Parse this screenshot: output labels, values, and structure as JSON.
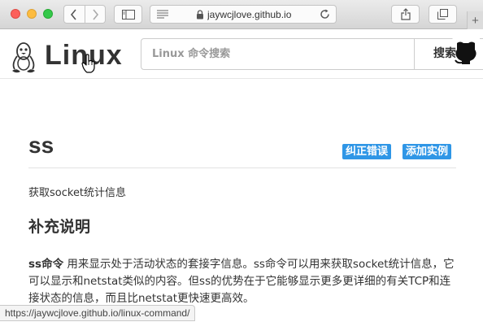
{
  "browser": {
    "url": "jaywcjlove.github.io",
    "status_url": "https://jaywcjlove.github.io/linux-command/",
    "new_tab": "+"
  },
  "header": {
    "logo_text": "Linux",
    "search_placeholder": "Linux 命令搜索",
    "search_button": "搜索"
  },
  "command": {
    "name": "ss",
    "fix_button": "纠正错误",
    "add_example_button": "添加实例",
    "description": "获取socket统计信息"
  },
  "section": {
    "heading": "补充说明",
    "lead_bold": "ss命令",
    "text": " 用来显示处于活动状态的套接字信息。ss命令可以用来获取socket统计信息，它可以显示和netstat类似的内容。但ss的优势在于它能够显示更多更详细的有关TCP和连接状态的信息，而且比netstat更快速更高效。"
  },
  "colors": {
    "accent": "#2f96e6"
  }
}
